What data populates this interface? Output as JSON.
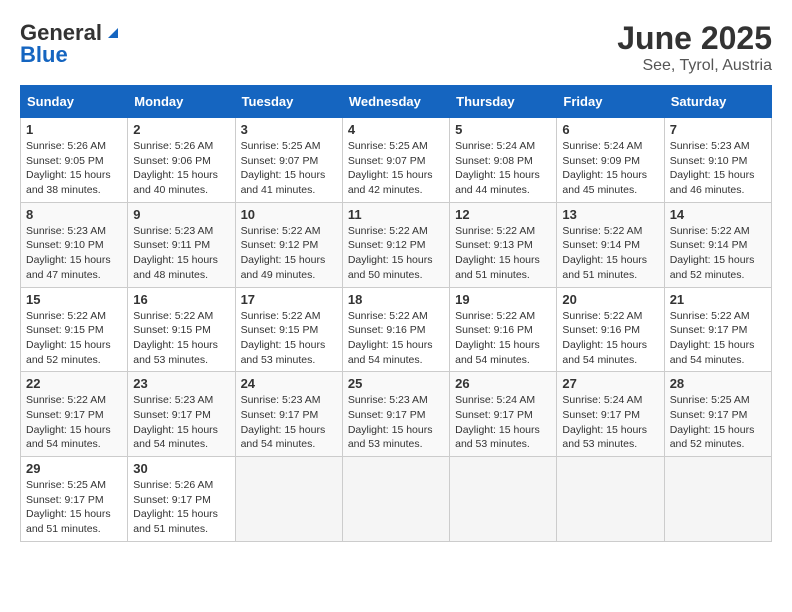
{
  "logo": {
    "general": "General",
    "blue": "Blue"
  },
  "title": {
    "month": "June 2025",
    "location": "See, Tyrol, Austria"
  },
  "headers": [
    "Sunday",
    "Monday",
    "Tuesday",
    "Wednesday",
    "Thursday",
    "Friday",
    "Saturday"
  ],
  "weeks": [
    [
      {
        "day": "1",
        "info": "Sunrise: 5:26 AM\nSunset: 9:05 PM\nDaylight: 15 hours\nand 38 minutes."
      },
      {
        "day": "2",
        "info": "Sunrise: 5:26 AM\nSunset: 9:06 PM\nDaylight: 15 hours\nand 40 minutes."
      },
      {
        "day": "3",
        "info": "Sunrise: 5:25 AM\nSunset: 9:07 PM\nDaylight: 15 hours\nand 41 minutes."
      },
      {
        "day": "4",
        "info": "Sunrise: 5:25 AM\nSunset: 9:07 PM\nDaylight: 15 hours\nand 42 minutes."
      },
      {
        "day": "5",
        "info": "Sunrise: 5:24 AM\nSunset: 9:08 PM\nDaylight: 15 hours\nand 44 minutes."
      },
      {
        "day": "6",
        "info": "Sunrise: 5:24 AM\nSunset: 9:09 PM\nDaylight: 15 hours\nand 45 minutes."
      },
      {
        "day": "7",
        "info": "Sunrise: 5:23 AM\nSunset: 9:10 PM\nDaylight: 15 hours\nand 46 minutes."
      }
    ],
    [
      {
        "day": "8",
        "info": "Sunrise: 5:23 AM\nSunset: 9:10 PM\nDaylight: 15 hours\nand 47 minutes."
      },
      {
        "day": "9",
        "info": "Sunrise: 5:23 AM\nSunset: 9:11 PM\nDaylight: 15 hours\nand 48 minutes."
      },
      {
        "day": "10",
        "info": "Sunrise: 5:22 AM\nSunset: 9:12 PM\nDaylight: 15 hours\nand 49 minutes."
      },
      {
        "day": "11",
        "info": "Sunrise: 5:22 AM\nSunset: 9:12 PM\nDaylight: 15 hours\nand 50 minutes."
      },
      {
        "day": "12",
        "info": "Sunrise: 5:22 AM\nSunset: 9:13 PM\nDaylight: 15 hours\nand 51 minutes."
      },
      {
        "day": "13",
        "info": "Sunrise: 5:22 AM\nSunset: 9:14 PM\nDaylight: 15 hours\nand 51 minutes."
      },
      {
        "day": "14",
        "info": "Sunrise: 5:22 AM\nSunset: 9:14 PM\nDaylight: 15 hours\nand 52 minutes."
      }
    ],
    [
      {
        "day": "15",
        "info": "Sunrise: 5:22 AM\nSunset: 9:15 PM\nDaylight: 15 hours\nand 52 minutes."
      },
      {
        "day": "16",
        "info": "Sunrise: 5:22 AM\nSunset: 9:15 PM\nDaylight: 15 hours\nand 53 minutes."
      },
      {
        "day": "17",
        "info": "Sunrise: 5:22 AM\nSunset: 9:15 PM\nDaylight: 15 hours\nand 53 minutes."
      },
      {
        "day": "18",
        "info": "Sunrise: 5:22 AM\nSunset: 9:16 PM\nDaylight: 15 hours\nand 54 minutes."
      },
      {
        "day": "19",
        "info": "Sunrise: 5:22 AM\nSunset: 9:16 PM\nDaylight: 15 hours\nand 54 minutes."
      },
      {
        "day": "20",
        "info": "Sunrise: 5:22 AM\nSunset: 9:16 PM\nDaylight: 15 hours\nand 54 minutes."
      },
      {
        "day": "21",
        "info": "Sunrise: 5:22 AM\nSunset: 9:17 PM\nDaylight: 15 hours\nand 54 minutes."
      }
    ],
    [
      {
        "day": "22",
        "info": "Sunrise: 5:22 AM\nSunset: 9:17 PM\nDaylight: 15 hours\nand 54 minutes."
      },
      {
        "day": "23",
        "info": "Sunrise: 5:23 AM\nSunset: 9:17 PM\nDaylight: 15 hours\nand 54 minutes."
      },
      {
        "day": "24",
        "info": "Sunrise: 5:23 AM\nSunset: 9:17 PM\nDaylight: 15 hours\nand 54 minutes."
      },
      {
        "day": "25",
        "info": "Sunrise: 5:23 AM\nSunset: 9:17 PM\nDaylight: 15 hours\nand 53 minutes."
      },
      {
        "day": "26",
        "info": "Sunrise: 5:24 AM\nSunset: 9:17 PM\nDaylight: 15 hours\nand 53 minutes."
      },
      {
        "day": "27",
        "info": "Sunrise: 5:24 AM\nSunset: 9:17 PM\nDaylight: 15 hours\nand 53 minutes."
      },
      {
        "day": "28",
        "info": "Sunrise: 5:25 AM\nSunset: 9:17 PM\nDaylight: 15 hours\nand 52 minutes."
      }
    ],
    [
      {
        "day": "29",
        "info": "Sunrise: 5:25 AM\nSunset: 9:17 PM\nDaylight: 15 hours\nand 51 minutes."
      },
      {
        "day": "30",
        "info": "Sunrise: 5:26 AM\nSunset: 9:17 PM\nDaylight: 15 hours\nand 51 minutes."
      },
      null,
      null,
      null,
      null,
      null
    ]
  ]
}
